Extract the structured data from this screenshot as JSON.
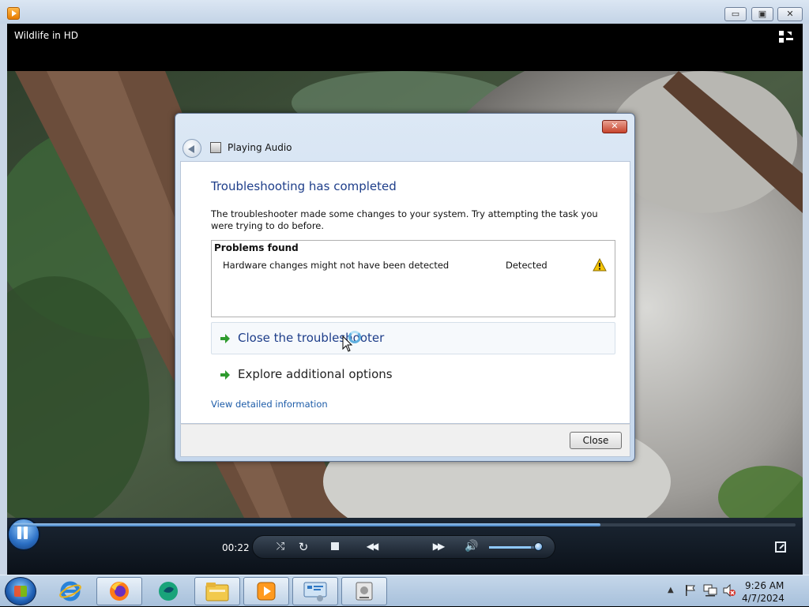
{
  "window": {
    "minimize_glyph": "▭",
    "maximize_glyph": "▣",
    "close_glyph": "✕"
  },
  "player": {
    "title": "Wildlife in HD",
    "elapsed": "00:22",
    "progress": 0.75,
    "volume": 0.85,
    "state": "playing"
  },
  "dialog": {
    "title": "Playing Audio",
    "close_glyph": "✕",
    "heading": "Troubleshooting has completed",
    "description": "The troubleshooter made some changes to your system. Try attempting the task you were trying to do before.",
    "problems_header": "Problems found",
    "problems": [
      {
        "name": "Hardware changes might not have been detected",
        "status": "Detected",
        "icon": "warning-icon"
      }
    ],
    "options": [
      {
        "label": "Close the troubleshooter",
        "icon": "green-arrow-icon"
      },
      {
        "label": "Explore additional options",
        "icon": "green-arrow-icon"
      }
    ],
    "link": "View detailed information",
    "close_label": "Close"
  },
  "controls": {
    "shuffle": "⤭",
    "repeat": "↻",
    "previous": "◀◀",
    "next": "▶▶",
    "mute": "🔊"
  },
  "taskbar": {
    "items": [
      {
        "name": "internet-explorer",
        "active": false
      },
      {
        "name": "firefox",
        "active": true
      },
      {
        "name": "app",
        "active": false
      },
      {
        "name": "file-explorer",
        "active": true
      },
      {
        "name": "windows-media-player",
        "active": true
      },
      {
        "name": "control-panel",
        "active": true
      },
      {
        "name": "troubleshooter",
        "active": true
      }
    ],
    "tray_chevron": "▲",
    "time": "9:26 AM",
    "date": "4/7/2024"
  },
  "colors": {
    "accent_blue": "#1e3e8a",
    "link_blue": "#1d5ca8",
    "arrow_green": "#2e9b2e",
    "warning_yellow": "#f5c400"
  }
}
